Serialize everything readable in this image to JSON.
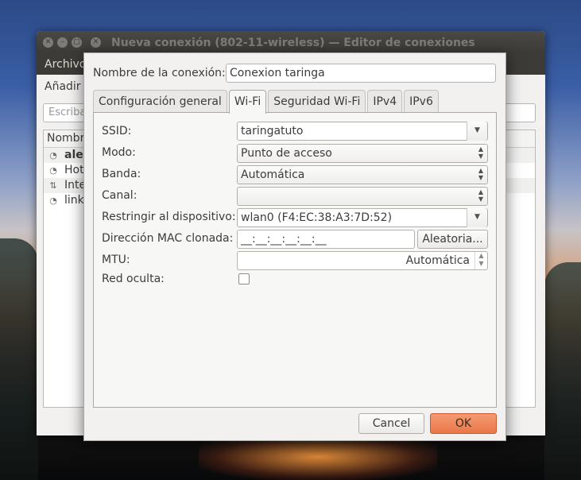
{
  "background_window": {
    "title": "Nueva conexión (802-11-wireless) — Editor de conexiones",
    "menu_label": "Archivo",
    "toolbar_label": "Añadir",
    "search_placeholder": "Escriba",
    "list_header": "Nombre",
    "list_items": [
      {
        "name": "alex",
        "icon": "wifi-icon",
        "bold": true
      },
      {
        "name": "Hot",
        "icon": "wifi-icon"
      },
      {
        "name": "Inte",
        "icon": "ethernet-icon"
      },
      {
        "name": "link",
        "icon": "wifi-icon"
      }
    ],
    "window_buttons": [
      "close",
      "minimize",
      "maximize"
    ]
  },
  "dialog": {
    "connection_name_label": "Nombre de la conexión:",
    "connection_name_value": "Conexion taringa",
    "tabs": [
      {
        "label": "Configuración general",
        "active": false
      },
      {
        "label": "Wi-Fi",
        "active": true
      },
      {
        "label": "Seguridad Wi-Fi",
        "active": false
      },
      {
        "label": "IPv4",
        "active": false
      },
      {
        "label": "IPv6",
        "active": false
      }
    ],
    "wifi": {
      "ssid_label": "SSID:",
      "ssid_value": "taringatuto",
      "mode_label": "Modo:",
      "mode_value": "Punto de acceso",
      "band_label": "Banda:",
      "band_value": "Automática",
      "channel_label": "Canal:",
      "channel_value": "",
      "device_label": "Restringir al dispositivo:",
      "device_value": "wlan0 (F4:EC:38:A3:7D:52)",
      "cloned_mac_label": "Dirección MAC clonada:",
      "cloned_mac_value": "__:__:__:__:__:__",
      "random_button": "Aleatoria...",
      "mtu_label": "MTU:",
      "mtu_value": "Automática",
      "hidden_label": "Red oculta:",
      "hidden_checked": false
    },
    "cancel_button": "Cancel",
    "ok_button": "OK"
  },
  "colors": {
    "ok_button": "#e9774a",
    "titlebar": "#3b3a37",
    "window_bg": "#f2f1f0"
  }
}
